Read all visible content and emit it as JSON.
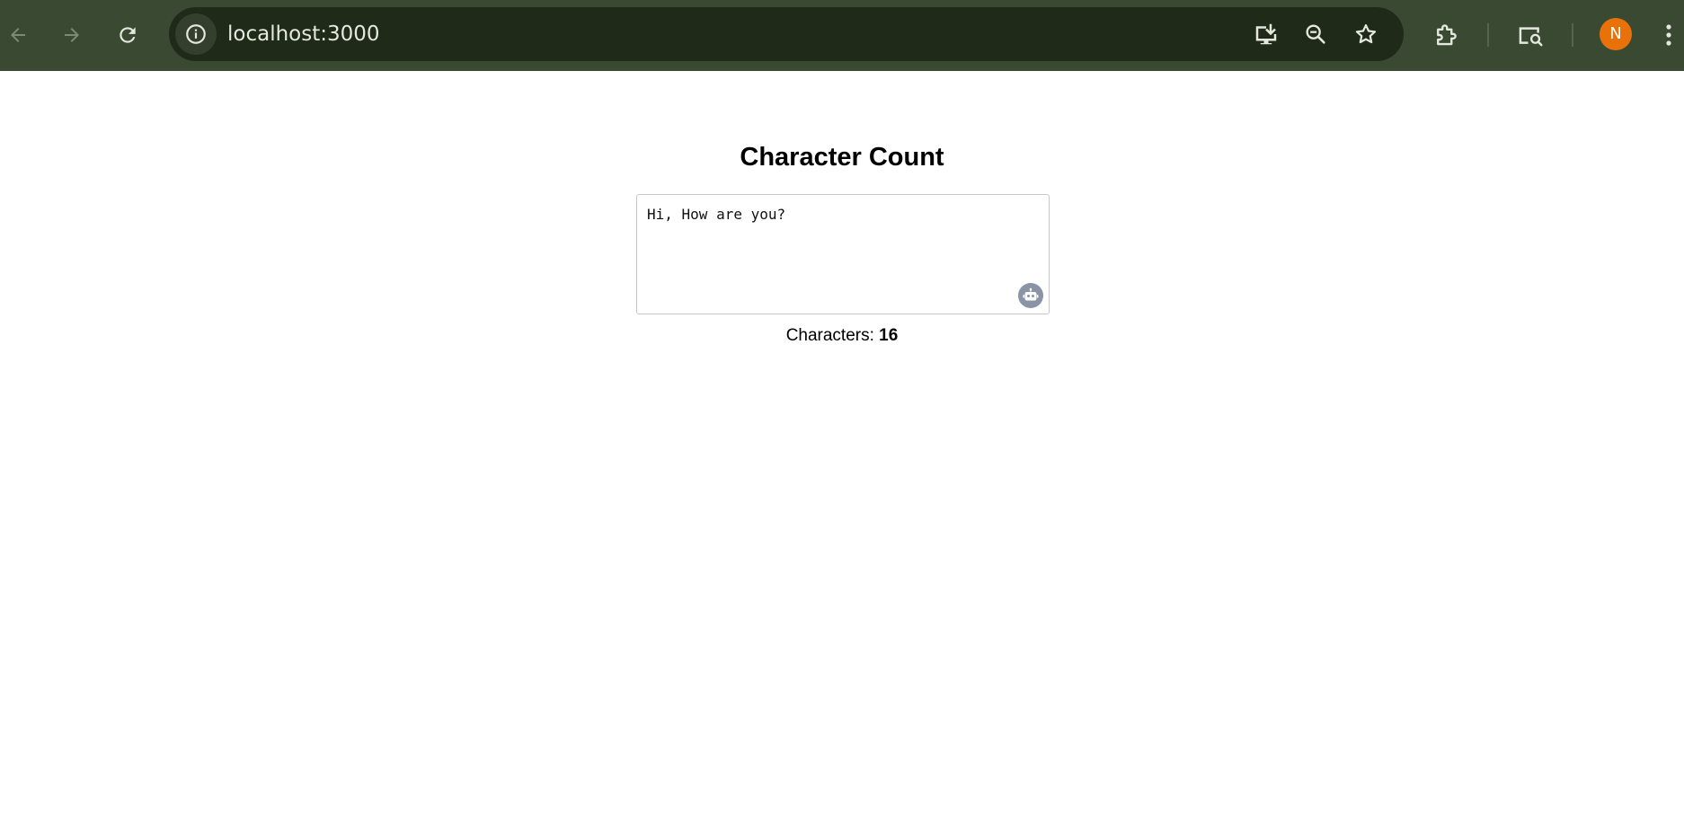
{
  "browser": {
    "url": "localhost:3000",
    "profile_initial": "N",
    "profile_color": "#e8710a",
    "icons": {
      "back": "back-arrow-icon",
      "forward": "forward-arrow-icon",
      "reload": "reload-icon",
      "site_info": "info-icon",
      "install": "install-app-icon",
      "zoom": "zoom-out-icon",
      "bookmark": "star-icon",
      "extensions": "puzzle-icon",
      "cast": "search-in-tab-icon",
      "menu": "kebab-menu-icon"
    }
  },
  "app": {
    "title": "Character Count",
    "textarea_value": "Hi, How are you?",
    "count_label": "Characters:",
    "count_value": "16",
    "assistant_icon": "robot-icon"
  }
}
